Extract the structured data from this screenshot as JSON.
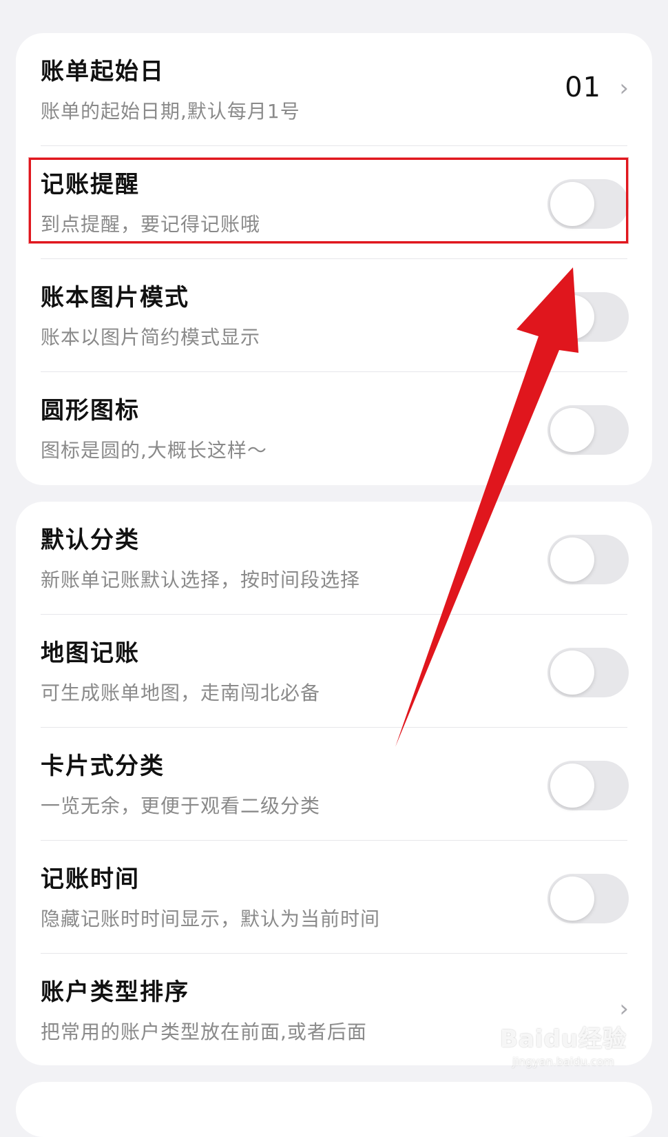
{
  "settings_group_1": [
    {
      "title": "账单起始日",
      "subtitle": "账单的起始日期,默认每月1号",
      "value": "01",
      "control": "chevron",
      "chevron": "›"
    },
    {
      "title": "记账提醒",
      "subtitle": "到点提醒，要记得记账哦",
      "control": "toggle",
      "on": false,
      "highlighted": true
    },
    {
      "title": "账本图片模式",
      "subtitle": "账本以图片简约模式显示",
      "control": "toggle",
      "on": false
    },
    {
      "title": "圆形图标",
      "subtitle": "图标是圆的,大概长这样～",
      "control": "toggle",
      "on": false
    }
  ],
  "settings_group_2": [
    {
      "title": "默认分类",
      "subtitle": "新账单记账默认选择，按时间段选择",
      "control": "toggle",
      "on": false
    },
    {
      "title": "地图记账",
      "subtitle": "可生成账单地图，走南闯北必备",
      "control": "toggle",
      "on": false
    },
    {
      "title": "卡片式分类",
      "subtitle": "一览无余，更便于观看二级分类",
      "control": "toggle",
      "on": false
    },
    {
      "title": "记账时间",
      "subtitle": "隐藏记账时时间显示，默认为当前时间",
      "control": "toggle",
      "on": false
    },
    {
      "title": "账户类型排序",
      "subtitle": "把常用的账户类型放在前面,或者后面",
      "control": "chevron",
      "chevron": "›"
    }
  ],
  "annotation": {
    "highlight_color": "#e0161d",
    "arrow_color": "#e0161d"
  },
  "watermark": {
    "logo": "Baidu经验",
    "url": "jingyan.baidu.com"
  },
  "colors": {
    "background": "#f2f2f5",
    "card": "#ffffff",
    "toggle_off": "#e7e7ea",
    "subtitle": "#8a8a8a"
  }
}
